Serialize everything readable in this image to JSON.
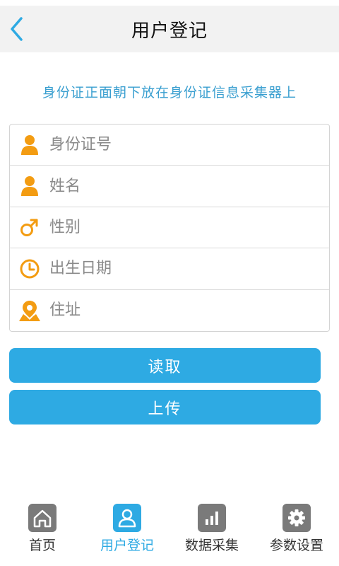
{
  "header": {
    "title": "用户登记"
  },
  "instruction": "身份证正面朝下放在身份证信息采集器上",
  "form": {
    "fields": [
      {
        "placeholder": "身份证号",
        "value": ""
      },
      {
        "placeholder": "姓名",
        "value": ""
      },
      {
        "placeholder": "性别",
        "value": ""
      },
      {
        "placeholder": "出生日期",
        "value": ""
      },
      {
        "placeholder": "住址",
        "value": ""
      }
    ]
  },
  "buttons": {
    "read": "读取",
    "upload": "上传"
  },
  "tabs": [
    {
      "label": "首页",
      "icon": "home-icon",
      "active": false
    },
    {
      "label": "用户登记",
      "icon": "user-icon",
      "active": true
    },
    {
      "label": "数据采集",
      "icon": "bar-chart-icon",
      "active": false
    },
    {
      "label": "参数设置",
      "icon": "gear-icon",
      "active": false
    }
  ],
  "colors": {
    "accent": "#2eaae3",
    "instruction": "#3a9fd0",
    "field_icon": "#f39c12",
    "tab_inactive": "#7a7a7a"
  }
}
